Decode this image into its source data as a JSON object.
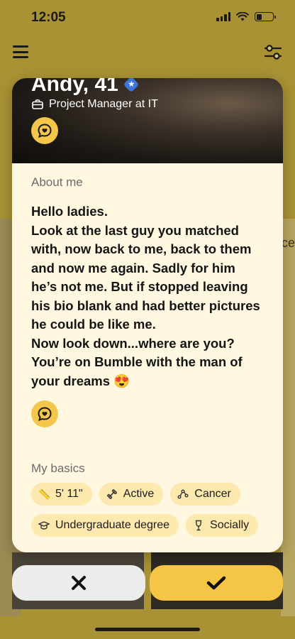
{
  "status_bar": {
    "time": "12:05",
    "battery_level": 0.35
  },
  "profile": {
    "name_age": "Andy, 41",
    "job": "Project Manager at IT",
    "about_title": "About me",
    "bio": "Hello ladies.\nLook at the last guy you matched with, now back to me, back to them and now me again. Sadly for him he’s not me. But if stopped leaving his bio blank and had better pictures he could be like me.\nNow look down...where are you? You’re on Bumble with the man of your dreams 😍",
    "basics_title": "My basics",
    "basics": [
      {
        "icon": "ruler-icon",
        "label": "5' 11\""
      },
      {
        "icon": "dumbbell-icon",
        "label": "Active"
      },
      {
        "icon": "zodiac-icon",
        "label": "Cancer"
      },
      {
        "icon": "graduation-cap-icon",
        "label": "Undergraduate degree"
      },
      {
        "icon": "wine-glass-icon",
        "label": "Socially"
      }
    ]
  },
  "background_peek_text": "ce",
  "colors": {
    "accent": "#f5c545",
    "card_bg": "#fff7e0",
    "chip_bg": "#fde9ad",
    "verified": "#3d74d9"
  }
}
